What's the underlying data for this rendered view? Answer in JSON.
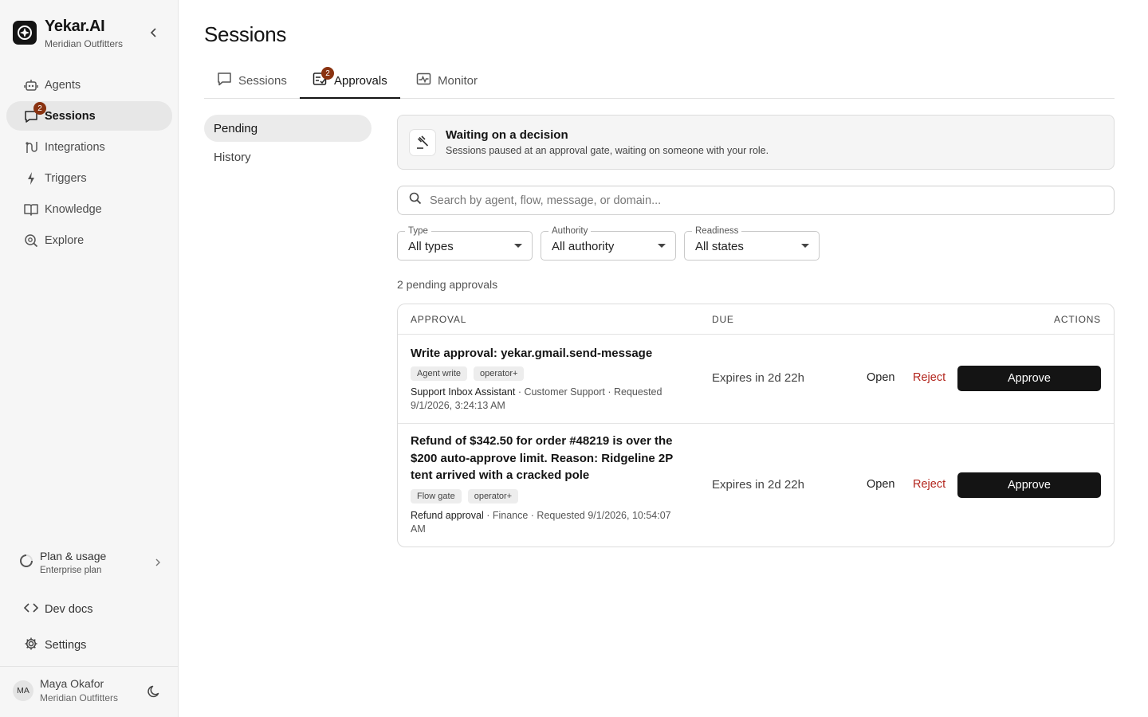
{
  "brand": {
    "name": "Yekar.AI",
    "org": "Meridian Outfitters"
  },
  "sidebar": {
    "items": [
      {
        "label": "Agents",
        "icon": "robot-icon"
      },
      {
        "label": "Sessions",
        "icon": "chat-bubble-icon",
        "badge": "2",
        "active": true
      },
      {
        "label": "Integrations",
        "icon": "integrations-icon"
      },
      {
        "label": "Triggers",
        "icon": "lightning-icon"
      },
      {
        "label": "Knowledge",
        "icon": "book-icon"
      },
      {
        "label": "Explore",
        "icon": "explore-search-icon"
      }
    ],
    "plan": {
      "title": "Plan & usage",
      "subtitle": "Enterprise plan"
    },
    "dev_docs": "Dev docs",
    "settings": "Settings",
    "user": {
      "initials": "MA",
      "name": "Maya Okafor",
      "org": "Meridian Outfitters"
    }
  },
  "page": {
    "title": "Sessions"
  },
  "tabs": [
    {
      "label": "Sessions",
      "icon": "chat-bubble-icon"
    },
    {
      "label": "Approvals",
      "icon": "approvals-icon",
      "badge": "2",
      "active": true
    },
    {
      "label": "Monitor",
      "icon": "monitor-icon"
    }
  ],
  "subnav": {
    "pending": "Pending",
    "history": "History"
  },
  "info": {
    "title": "Waiting on a decision",
    "subtitle": "Sessions paused at an approval gate, waiting on someone with your role."
  },
  "search": {
    "placeholder": "Search by agent, flow, message, or domain..."
  },
  "filters": [
    {
      "label": "Type",
      "value": "All types"
    },
    {
      "label": "Authority",
      "value": "All authority"
    },
    {
      "label": "Readiness",
      "value": "All states"
    }
  ],
  "count_text": "2 pending approvals",
  "table": {
    "headers": {
      "approval": "APPROVAL",
      "due": "DUE",
      "actions": "ACTIONS"
    },
    "rows": [
      {
        "title": "Write approval: yekar.gmail.send-message",
        "tags": [
          "Agent write",
          "operator+"
        ],
        "agent": "Support Inbox Assistant",
        "meta": " · Customer Support · Requested 9/1/2026, 3:24:13 AM",
        "due": "Expires in 2d 22h",
        "open": "Open",
        "reject": "Reject",
        "approve": "Approve"
      },
      {
        "title": "Refund of $342.50 for order #48219 is over the $200 auto-approve limit. Reason: Ridgeline 2P tent arrived with a cracked pole",
        "tags": [
          "Flow gate",
          "operator+"
        ],
        "agent": "Refund approval",
        "meta": " · Finance · Requested 9/1/2026, 10:54:07 AM",
        "due": "Expires in 2d 22h",
        "open": "Open",
        "reject": "Reject",
        "approve": "Approve"
      }
    ]
  },
  "colors": {
    "badge": "#8a3311",
    "reject": "#b3261e",
    "approve_bg": "#141414"
  }
}
